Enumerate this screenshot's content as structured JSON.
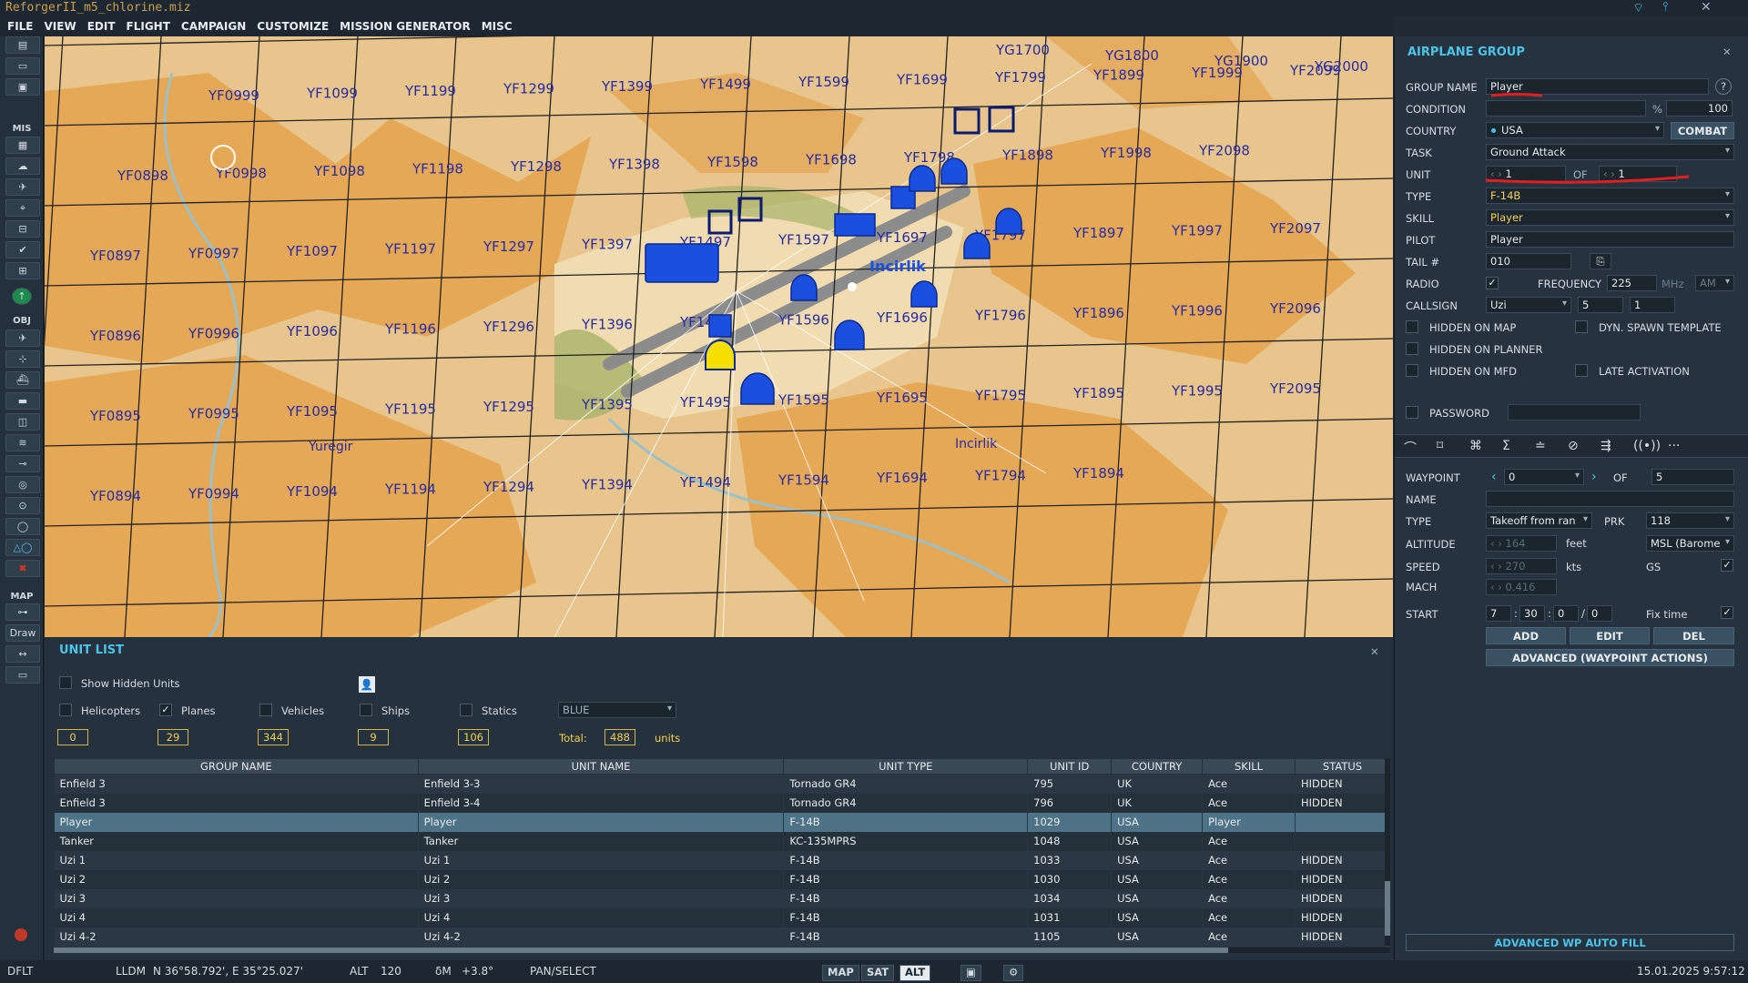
{
  "window": {
    "title": "ReforgerII_m5_chlorine.miz"
  },
  "menu": [
    "FILE",
    "VIEW",
    "EDIT",
    "FLIGHT",
    "CAMPAIGN",
    "CUSTOMIZE",
    "MISSION GENERATOR",
    "MISC"
  ],
  "toolbar": {
    "mis_label": "MIS",
    "obj_label": "OBJ",
    "map_label": "MAP",
    "draw_label": "Draw"
  },
  "map": {
    "grid_labels": [
      {
        "t": "YF0999"
      },
      {
        "t": "YF1099"
      },
      {
        "t": "YF1199"
      },
      {
        "t": "YF1299"
      },
      {
        "t": "YF1399"
      },
      {
        "t": "YF1499"
      },
      {
        "t": "YF1599"
      },
      {
        "t": "YF1699"
      },
      {
        "t": "YF1799"
      },
      {
        "t": "YF1899"
      },
      {
        "t": "YF1999"
      },
      {
        "t": "YF2099"
      },
      {
        "t": "YF0898"
      },
      {
        "t": "YF0998"
      },
      {
        "t": "YF1098"
      },
      {
        "t": "YF1198"
      },
      {
        "t": "YF1298"
      },
      {
        "t": "YF1398"
      },
      {
        "t": "YF1598"
      },
      {
        "t": "YF1698"
      },
      {
        "t": "YF1798"
      },
      {
        "t": "YF1898"
      },
      {
        "t": "YF1998"
      },
      {
        "t": "YF2098"
      },
      {
        "t": "YF0897"
      },
      {
        "t": "YF0997"
      },
      {
        "t": "YF1097"
      },
      {
        "t": "YF1197"
      },
      {
        "t": "YF1297"
      },
      {
        "t": "YF1397"
      },
      {
        "t": "YF1497"
      },
      {
        "t": "YF1597"
      },
      {
        "t": "YF1697"
      },
      {
        "t": "YF1797"
      },
      {
        "t": "YF1897"
      },
      {
        "t": "YF1997"
      },
      {
        "t": "YF2097"
      },
      {
        "t": "YF0896"
      },
      {
        "t": "YF0996"
      },
      {
        "t": "YF1096"
      },
      {
        "t": "YF1196"
      },
      {
        "t": "YF1296"
      },
      {
        "t": "YF1396"
      },
      {
        "t": "YF1496"
      },
      {
        "t": "YF1596"
      },
      {
        "t": "YF1696"
      },
      {
        "t": "YF1796"
      },
      {
        "t": "YF1896"
      },
      {
        "t": "YF1996"
      },
      {
        "t": "YF2096"
      },
      {
        "t": "YF0895"
      },
      {
        "t": "YF0995"
      },
      {
        "t": "YF1095"
      },
      {
        "t": "YF1195"
      },
      {
        "t": "YF1295"
      },
      {
        "t": "YF1395"
      },
      {
        "t": "YF1495"
      },
      {
        "t": "YF1595"
      },
      {
        "t": "YF1695"
      },
      {
        "t": "YF1795"
      },
      {
        "t": "YF1895"
      },
      {
        "t": "YF1995"
      },
      {
        "t": "YF2095"
      },
      {
        "t": "YF0894"
      },
      {
        "t": "YF0994"
      },
      {
        "t": "YF1094"
      },
      {
        "t": "YF1194"
      },
      {
        "t": "YF1294"
      },
      {
        "t": "YF1394"
      },
      {
        "t": "YF1494"
      },
      {
        "t": "YF1594"
      },
      {
        "t": "YF1694"
      },
      {
        "t": "YF1794"
      },
      {
        "t": "YF1894"
      },
      {
        "t": "YG1700"
      },
      {
        "t": "YG1800"
      },
      {
        "t": "YG1900"
      },
      {
        "t": "YG2000"
      }
    ],
    "place_labels": {
      "incirlik_base": "Incirlik",
      "incirlik_town": "Incirlik",
      "yuregir": "Yuregir"
    }
  },
  "airplane_group": {
    "title": "AIRPLANE GROUP",
    "group_name_label": "GROUP NAME",
    "group_name": "Player",
    "condition_label": "CONDITION",
    "condition_pct": "%",
    "condition_value": "100",
    "country_label": "COUNTRY",
    "country": "USA",
    "combat_button": "COMBAT",
    "task_label": "TASK",
    "task": "Ground Attack",
    "unit_label": "UNIT",
    "unit_index": "1",
    "unit_of": "OF",
    "unit_total": "1",
    "type_label": "TYPE",
    "type": "F-14B",
    "skill_label": "SKILL",
    "skill": "Player",
    "pilot_label": "PILOT",
    "pilot": "Player",
    "tail_label": "TAIL #",
    "tail": "010",
    "radio_label": "RADIO",
    "frequency_label": "FREQUENCY",
    "frequency": "225",
    "freq_unit": "MHz",
    "modulation": "AM",
    "callsign_label": "CALLSIGN",
    "callsign_name": "Uzi",
    "callsign_num1": "5",
    "callsign_num2": "1",
    "hidden_on_map": "HIDDEN ON MAP",
    "dyn_spawn": "DYN. SPAWN TEMPLATE",
    "hidden_on_planner": "HIDDEN ON PLANNER",
    "hidden_on_mfd": "HIDDEN ON MFD",
    "late_activation": "LATE ACTIVATION",
    "password_label": "PASSWORD"
  },
  "waypoint": {
    "waypoint_label": "WAYPOINT",
    "waypoint_index": "0",
    "of_label": "OF",
    "waypoint_total": "5",
    "name_label": "NAME",
    "type_label": "TYPE",
    "type": "Takeoff from ran",
    "prk_label": "PRK",
    "prk": "118",
    "altitude_label": "ALTITUDE",
    "altitude": "164",
    "altitude_unit": "feet",
    "altitude_ref": "MSL (Barome",
    "speed_label": "SPEED",
    "speed": "270",
    "speed_unit": "kts",
    "gs_label": "GS",
    "mach_label": "MACH",
    "mach": "0.416",
    "start_label": "START",
    "start_d": "7",
    "start_h": "30",
    "start_m": "0",
    "start_s": "0",
    "fix_time_label": "Fix time",
    "add_button": "ADD",
    "edit_button": "EDIT",
    "del_button": "DEL",
    "advanced_button": "ADVANCED (WAYPOINT ACTIONS)",
    "auto_fill_button": "ADVANCED WP AUTO FILL"
  },
  "unit_list": {
    "title": "UNIT LIST",
    "show_hidden": "Show Hidden Units",
    "filters": [
      {
        "label": "Helicopters",
        "count": "0",
        "checked": ""
      },
      {
        "label": "Planes",
        "count": "29",
        "checked": "✓"
      },
      {
        "label": "Vehicles",
        "count": "344",
        "checked": ""
      },
      {
        "label": "Ships",
        "count": "9",
        "checked": ""
      },
      {
        "label": "Statics",
        "count": "106",
        "checked": ""
      }
    ],
    "coalition": "BLUE",
    "total_label": "Total:",
    "total": "488",
    "units_label": "units",
    "columns": [
      "GROUP NAME",
      "UNIT NAME",
      "UNIT TYPE",
      "UNIT ID",
      "COUNTRY",
      "SKILL",
      "STATUS"
    ],
    "rows": [
      [
        "Enfield 3",
        "Enfield 3-3",
        "Tornado GR4",
        "795",
        "UK",
        "Ace",
        "HIDDEN"
      ],
      [
        "Enfield 3",
        "Enfield 3-4",
        "Tornado GR4",
        "796",
        "UK",
        "Ace",
        "HIDDEN"
      ],
      [
        "Player",
        "Player",
        "F-14B",
        "1029",
        "USA",
        "Player",
        ""
      ],
      [
        "Tanker",
        "Tanker",
        "KC-135MPRS",
        "1048",
        "USA",
        "Ace",
        ""
      ],
      [
        "Uzi 1",
        "Uzi 1",
        "F-14B",
        "1033",
        "USA",
        "Ace",
        "HIDDEN"
      ],
      [
        "Uzi 2",
        "Uzi 2",
        "F-14B",
        "1030",
        "USA",
        "Ace",
        "HIDDEN"
      ],
      [
        "Uzi 3",
        "Uzi 3",
        "F-14B",
        "1034",
        "USA",
        "Ace",
        "HIDDEN"
      ],
      [
        "Uzi 4",
        "Uzi 4",
        "F-14B",
        "1031",
        "USA",
        "Ace",
        "HIDDEN"
      ],
      [
        "Uzi 4-2",
        "Uzi 4-2",
        "F-14B",
        "1105",
        "USA",
        "Ace",
        "HIDDEN"
      ]
    ]
  },
  "status_bar": {
    "profile": "DFLT",
    "coord_sys": "LLDM",
    "coords": "N 36°58.792', E 35°25.027'",
    "alt_label": "ALT",
    "alt": "120",
    "dm_label": "δM",
    "dm": "+3.8°",
    "mode": "PAN/SELECT",
    "map_btn": "MAP",
    "sat_btn": "SAT",
    "alt_btn": "ALT",
    "datetime": "15.01.2025 9:57:12"
  },
  "colors": {
    "accent": "#4cc3ea",
    "map_land": "#e7c58c",
    "map_urban": "#e4a24e",
    "units_blue": "#1a4fe0",
    "player": "#f5e000"
  }
}
